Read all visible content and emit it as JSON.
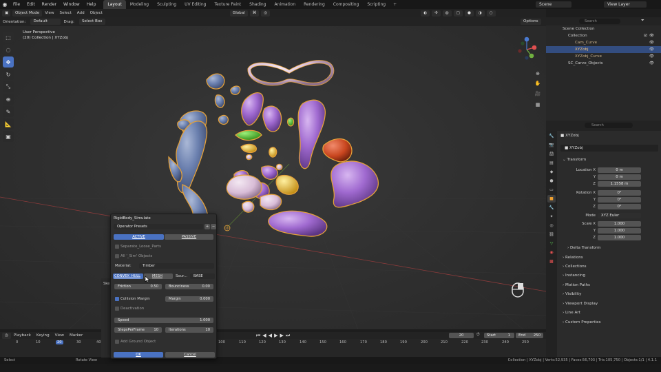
{
  "topbar": {
    "menus": [
      "File",
      "Edit",
      "Render",
      "Window",
      "Help"
    ],
    "workspaces": [
      "Layout",
      "Modeling",
      "Sculpting",
      "UV Editing",
      "Texture Paint",
      "Shading",
      "Animation",
      "Rendering",
      "Compositing",
      "Scripting"
    ],
    "active_workspace": "Layout",
    "scene": "Scene",
    "view_layer": "View Layer"
  },
  "header": {
    "mode": "Object Mode",
    "menus": [
      "View",
      "Select",
      "Add",
      "Object"
    ],
    "transform_orientation": "Global",
    "options": "Options"
  },
  "tool_settings": {
    "orientation_label": "Orientation:",
    "orientation_value": "Default",
    "drag_label": "Drag:",
    "drag_value": "Select Box"
  },
  "viewport": {
    "perspective": "User Perspective",
    "collection_info": "(20) Collection | XYZobj",
    "gizmo_axes": [
      "X",
      "Y",
      "Z"
    ]
  },
  "outliner": {
    "search_placeholder": "Search",
    "rows": [
      {
        "label": "Scene Collection",
        "indent": 0,
        "selected": false
      },
      {
        "label": "Collection",
        "indent": 1,
        "selected": false
      },
      {
        "label": "Cam_Curve",
        "indent": 2,
        "selected": false
      },
      {
        "label": "XYZobj",
        "indent": 2,
        "selected": true
      },
      {
        "label": "XYZobj_Curve",
        "indent": 2,
        "selected": false
      },
      {
        "label": "SC_Carve_Objects",
        "indent": 1,
        "selected": false
      }
    ]
  },
  "properties": {
    "search_placeholder": "Search",
    "object_name": "XYZobj",
    "data_name": "XYZobj",
    "transform_section": "Transform",
    "location": {
      "label": "Location X",
      "x": "0 m",
      "y": "0 m",
      "z": "1.1558 m"
    },
    "rotation": {
      "label": "Rotation X",
      "x": "0°",
      "y": "0°",
      "z": "0°"
    },
    "mode_label": "Mode",
    "mode_value": "XYZ Euler",
    "scale": {
      "label": "Scale X",
      "x": "1.000",
      "y": "1.000",
      "z": "1.000"
    },
    "axis_y": "Y",
    "axis_z": "Z",
    "sections": [
      "Delta Transform",
      "Relations",
      "Collections",
      "Instancing",
      "Motion Paths",
      "Visibility",
      "Viewport Display",
      "Line Art",
      "Custom Properties"
    ]
  },
  "dialog": {
    "title": "RigidBody_Simulate",
    "presets": "Operator Presets",
    "active_tab": "ACTIVE",
    "passive_tab": "PASSIVE",
    "separate_loose": "Separate_Loose_Parts",
    "all_sim": "All '_Sim' Objects",
    "material_label": "Material:",
    "material_value": "Timber",
    "shape_convex": "CONVEX_HULL",
    "shape_mesh": "MESH",
    "source_label": "Sour...",
    "source_value": "BASE",
    "friction_label": "Friction",
    "friction_value": "0.50",
    "bounciness_label": "Bounciness",
    "bounciness_value": "0.00",
    "collision_margin": "Collision Margin",
    "margin_label": "Margin",
    "margin_value": "0.000",
    "deactivation": "Deactivation",
    "speed_label": "Speed",
    "speed_value": "1.000",
    "spf_label": "StepsPerFrame",
    "spf_value": "10",
    "iterations_label": "Iterations",
    "iterations_value": "10",
    "ground": "Add Ground Object",
    "ok": "OK",
    "cancel": "Cancel",
    "behind_panel": "Ske"
  },
  "timeline": {
    "menus": [
      "Playback",
      "Keying",
      "View",
      "Marker"
    ],
    "current_frame": "20",
    "start_label": "Start",
    "start": "1",
    "end_label": "End",
    "end": "250",
    "ticks": [
      "0",
      "10",
      "20",
      "30",
      "40",
      "100",
      "110",
      "120",
      "130",
      "140",
      "150",
      "160",
      "170",
      "180",
      "190",
      "200",
      "210",
      "220",
      "230",
      "240",
      "250"
    ]
  },
  "status": {
    "select": "Select",
    "rotate": "Rotate View",
    "stats": "Collection | XYZobj | Verts:52,935 | Faces:56,703 | Tris:105,750 | Objects:1/1 | 4.1.1"
  },
  "colors": {
    "accent": "#4a72c2",
    "selection": "#334d80",
    "panel": "#2b2b2b",
    "viewport": "#303030"
  }
}
